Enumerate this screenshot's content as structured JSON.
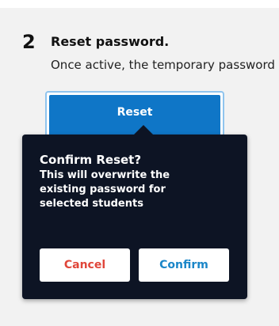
{
  "step": {
    "number": "2",
    "title": "Reset password.",
    "description": "Once active, the temporary password"
  },
  "reset_button": {
    "label": "Reset"
  },
  "popover": {
    "title": "Confirm Reset?",
    "message": "This will overwrite the existing password for selected students",
    "cancel_label": "Cancel",
    "confirm_label": "Confirm"
  },
  "colors": {
    "primary": "#0f76c7",
    "popover_bg": "#0d1424",
    "cancel_text": "#e0463a",
    "confirm_text": "#1a86c8"
  }
}
